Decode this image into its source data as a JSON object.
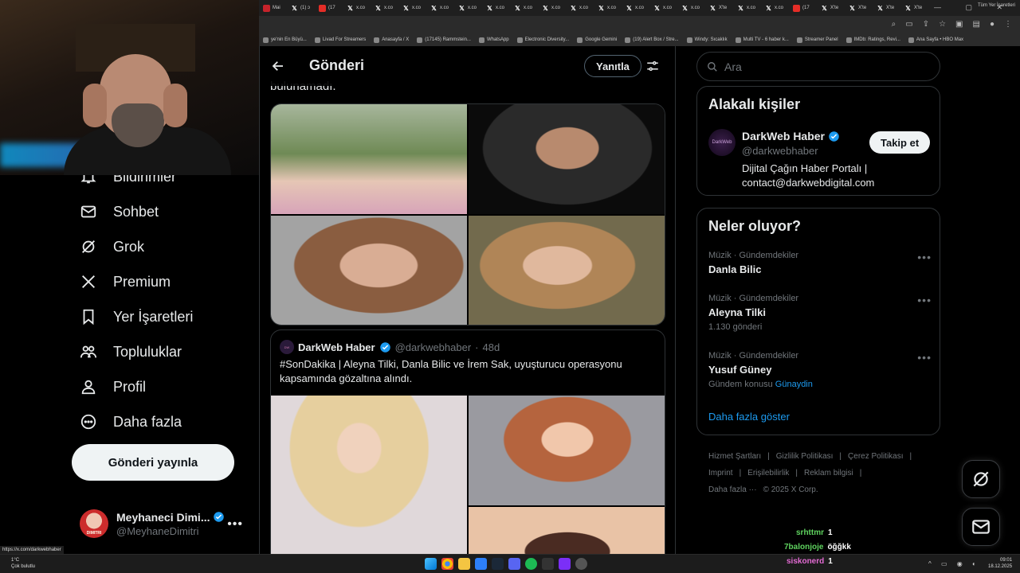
{
  "browser": {
    "tabs": [
      {
        "label": "Mai",
        "icon": "red"
      },
      {
        "label": "(1) ɔ",
        "icon": "x"
      },
      {
        "label": "(17",
        "icon": "yt"
      },
      {
        "label": "x.co",
        "icon": "x"
      },
      {
        "label": "x.co",
        "icon": "x"
      },
      {
        "label": "x.co",
        "icon": "x"
      },
      {
        "label": "x.co",
        "icon": "x"
      },
      {
        "label": "x.co",
        "icon": "x"
      },
      {
        "label": "x.co",
        "icon": "x"
      },
      {
        "label": "x.co",
        "icon": "x"
      },
      {
        "label": "x.co",
        "icon": "x"
      },
      {
        "label": "x.co",
        "icon": "x"
      },
      {
        "label": "x.co",
        "icon": "x"
      },
      {
        "label": "x.co",
        "icon": "x"
      },
      {
        "label": "x.co",
        "icon": "x"
      },
      {
        "label": "x.co",
        "icon": "x"
      },
      {
        "label": "X'te",
        "icon": "x"
      },
      {
        "label": "x.co",
        "icon": "x"
      },
      {
        "label": "x.co",
        "icon": "x"
      },
      {
        "label": "(17",
        "icon": "yt"
      },
      {
        "label": "X'te",
        "icon": "x"
      },
      {
        "label": "X'te",
        "icon": "x"
      },
      {
        "label": "X'te",
        "icon": "x"
      },
      {
        "label": "X'te",
        "icon": "x"
      }
    ],
    "bookmarks": [
      "ye'nin En Büyü...",
      "Livad For Streamers",
      "Anasayfa / X",
      "(17145) Rammstein...",
      "WhatsApp",
      "Electronic Diversity...",
      "Google Gemini",
      "(19) Alert Box / Stre...",
      "Windy: Sıcaklık",
      "Multi TV - 6 haber k...",
      "Streamer Panel",
      "IMDb: Ratings, Revi...",
      "Ana Sayfa • HBO Max"
    ],
    "bookmarks_right": "Tüm Yer İşaretleri",
    "status_url": "https://x.com/darkwebhaber"
  },
  "nav": {
    "items": [
      {
        "label": "Bildirimler",
        "icon": "bell-icon"
      },
      {
        "label": "Sohbet",
        "icon": "mail-icon"
      },
      {
        "label": "Grok",
        "icon": "grok-icon"
      },
      {
        "label": "Premium",
        "icon": "x-logo-icon"
      },
      {
        "label": "Yer İşaretleri",
        "icon": "bookmark-icon"
      },
      {
        "label": "Topluluklar",
        "icon": "communities-icon"
      },
      {
        "label": "Profil",
        "icon": "profile-icon"
      },
      {
        "label": "Daha fazla",
        "icon": "more-circle-icon"
      }
    ],
    "post_button": "Gönderi yayınla"
  },
  "account": {
    "name": "Meyhaneci Dimi...",
    "handle": "@MeyhaneDimitri",
    "avatar_text": "DIMITRI"
  },
  "main": {
    "title": "Gönderi",
    "reply_button": "Yanıtla",
    "cut_text": "bulunamadı.",
    "quote": {
      "name": "DarkWeb Haber",
      "handle": "@darkwebhaber",
      "sep": "·",
      "time": "48d",
      "text": "#SonDakika | Aleyna Tilki, Danla Bilic ve İrem Sak, uyuşturucu operasyonu kapsamında gözaltına alındı."
    }
  },
  "right": {
    "search_placeholder": "Ara",
    "related": {
      "title": "Alakalı kişiler",
      "name": "DarkWeb Haber",
      "handle": "@darkwebhaber",
      "bio": "Dijital Çağın Haber Portalı | contact@darkwebdigital.com",
      "follow": "Takip et",
      "avatar_text": "DarkWeb"
    },
    "trends": {
      "title": "Neler oluyor?",
      "items": [
        {
          "meta": "Müzik · Gündemdekiler",
          "name": "Danla Bilic",
          "sub": ""
        },
        {
          "meta": "Müzik · Gündemdekiler",
          "name": "Aleyna Tilki",
          "sub": "1.130 gönderi"
        },
        {
          "meta": "Müzik · Gündemdekiler",
          "name": "Yusuf Güney",
          "sub": "Gündem konusu",
          "sub_link": "Günaydin"
        }
      ],
      "show_more": "Daha fazla göster"
    },
    "footer": [
      "Hizmet Şartları",
      "|",
      "Gizlilik Politikası",
      "|",
      "Çerez Politikası",
      "|",
      "Imprint",
      "|",
      "Erişilebilirlik",
      "|",
      "Reklam bilgisi",
      "|",
      "Daha fazla ···",
      "© 2025 X Corp."
    ]
  },
  "chat": [
    {
      "user": "srhttmr",
      "msg": "1"
    },
    {
      "user": "7balonjoje",
      "msg": "öğğkk"
    },
    {
      "user": "siskonerd",
      "msg": "1"
    }
  ],
  "taskbar": {
    "temp": "1°C",
    "weather": "Çok bulutlu",
    "time": "09:01",
    "date": "18.12.2025"
  },
  "colors": {
    "accent": "#1d9bf0",
    "verified": "#1d9bf0",
    "border": "#2f3336",
    "muted": "#71767b"
  }
}
